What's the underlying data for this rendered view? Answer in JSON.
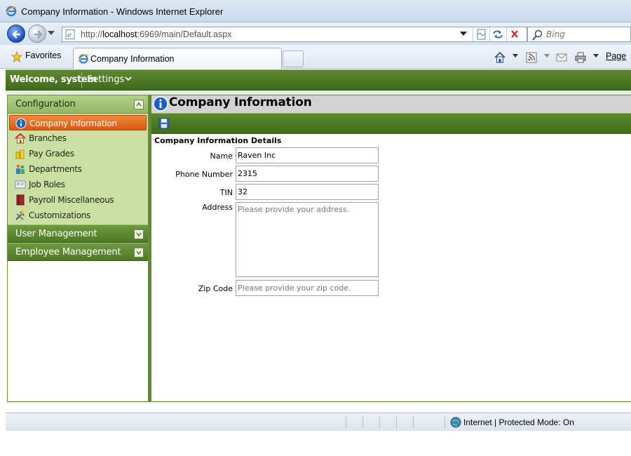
{
  "window": {
    "title": "Company Information - Windows Internet Explorer"
  },
  "browser": {
    "address_host": "http://",
    "address_bold": "localhost",
    "address_rest": ":6969/main/Default.aspx",
    "search_placeholder": "Bing",
    "favorites_label": "Favorites",
    "tab_label": "Company Information",
    "page_menu_label": "Page"
  },
  "app": {
    "welcome": "Welcome, system",
    "settings_label": "Settings",
    "accent_color": "#4f7d22",
    "active_color": "#e0661c"
  },
  "sidebar": {
    "configuration": {
      "title": "Configuration",
      "items": [
        {
          "label": "Company Information",
          "icon": "info-icon",
          "active": true
        },
        {
          "label": "Branches",
          "icon": "house-icon",
          "active": false
        },
        {
          "label": "Pay Grades",
          "icon": "coins-icon",
          "active": false
        },
        {
          "label": "Departments",
          "icon": "people-icon",
          "active": false
        },
        {
          "label": "Job Roles",
          "icon": "card-icon",
          "active": false
        },
        {
          "label": "Payroll Miscellaneous",
          "icon": "book-icon",
          "active": false
        },
        {
          "label": "Customizations",
          "icon": "tools-icon",
          "active": false
        }
      ]
    },
    "user_management": {
      "title": "User Management"
    },
    "employee_management": {
      "title": "Employee Management"
    }
  },
  "main": {
    "title": "Company Information",
    "section_heading": "Company Information Details",
    "fields": {
      "name": {
        "label": "Name",
        "value": "Raven Inc"
      },
      "phone": {
        "label": "Phone Number",
        "value": "2315"
      },
      "tin": {
        "label": "TIN",
        "value": "32"
      },
      "address": {
        "label": "Address",
        "value": "",
        "placeholder": "Please provide your address."
      },
      "zip": {
        "label": "Zip Code",
        "value": "",
        "placeholder": "Please provide your zip code."
      }
    }
  },
  "status": {
    "zone": "Internet | Protected Mode: On"
  }
}
